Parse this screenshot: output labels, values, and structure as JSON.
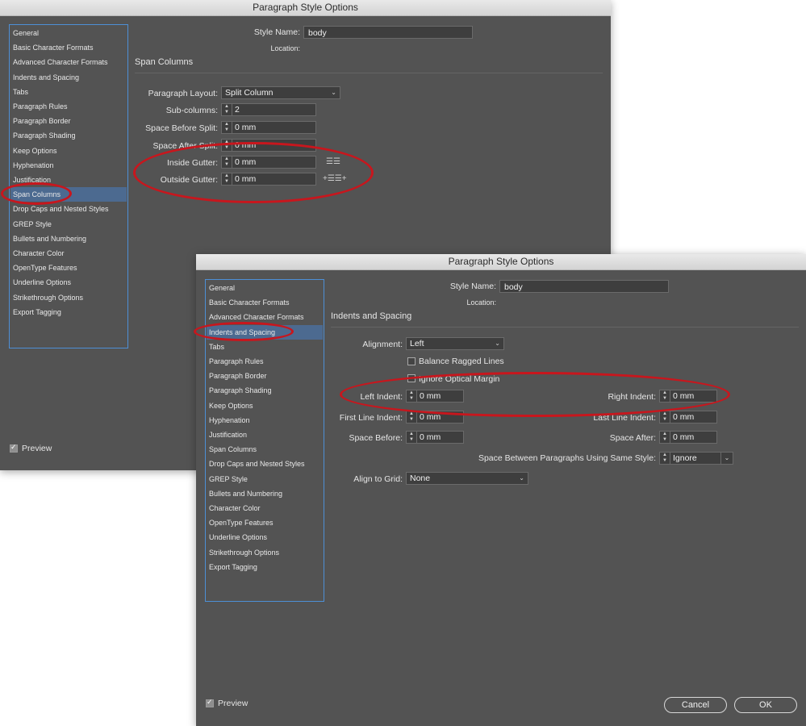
{
  "window1": {
    "title": "Paragraph Style Options",
    "categories": [
      "General",
      "Basic Character Formats",
      "Advanced Character Formats",
      "Indents and Spacing",
      "Tabs",
      "Paragraph Rules",
      "Paragraph Border",
      "Paragraph Shading",
      "Keep Options",
      "Hyphenation",
      "Justification",
      "Span Columns",
      "Drop Caps and Nested Styles",
      "GREP Style",
      "Bullets and Numbering",
      "Character Color",
      "OpenType Features",
      "Underline Options",
      "Strikethrough Options",
      "Export Tagging"
    ],
    "selected": "Span Columns",
    "style_name_label": "Style Name:",
    "style_name_value": "body",
    "location_label": "Location:",
    "section_title": "Span Columns",
    "paragraph_layout_label": "Paragraph Layout:",
    "paragraph_layout_value": "Split Column",
    "sub_columns_label": "Sub-columns:",
    "sub_columns_value": "2",
    "space_before_split_label": "Space Before Split:",
    "space_before_split_value": "0 mm",
    "space_after_split_label": "Space After Split:",
    "space_after_split_value": "0 mm",
    "inside_gutter_label": "Inside Gutter:",
    "inside_gutter_value": "0 mm",
    "outside_gutter_label": "Outside Gutter:",
    "outside_gutter_value": "0 mm",
    "preview_label": "Preview",
    "preview_checked": true
  },
  "window2": {
    "title": "Paragraph Style Options",
    "categories": [
      "General",
      "Basic Character Formats",
      "Advanced Character Formats",
      "Indents and Spacing",
      "Tabs",
      "Paragraph Rules",
      "Paragraph Border",
      "Paragraph Shading",
      "Keep Options",
      "Hyphenation",
      "Justification",
      "Span Columns",
      "Drop Caps and Nested Styles",
      "GREP Style",
      "Bullets and Numbering",
      "Character Color",
      "OpenType Features",
      "Underline Options",
      "Strikethrough Options",
      "Export Tagging"
    ],
    "selected": "Indents and Spacing",
    "style_name_label": "Style Name:",
    "style_name_value": "body",
    "location_label": "Location:",
    "section_title": "Indents and Spacing",
    "alignment_label": "Alignment:",
    "alignment_value": "Left",
    "balance_ragged_label": "Balance Ragged Lines",
    "ignore_optical_label": "Ignore Optical Margin",
    "left_indent_label": "Left Indent:",
    "left_indent_value": "0 mm",
    "right_indent_label": "Right Indent:",
    "right_indent_value": "0 mm",
    "first_line_indent_label": "First Line Indent:",
    "first_line_indent_value": "0 mm",
    "last_line_indent_label": "Last Line Indent:",
    "last_line_indent_value": "0 mm",
    "space_before_label": "Space Before:",
    "space_before_value": "0 mm",
    "space_after_label": "Space After:",
    "space_after_value": "0 mm",
    "space_between_label": "Space Between Paragraphs Using Same Style:",
    "space_between_value": "Ignore",
    "align_grid_label": "Align to Grid:",
    "align_grid_value": "None",
    "preview_label": "Preview",
    "preview_checked": true,
    "cancel_label": "Cancel",
    "ok_label": "OK"
  },
  "colors": {
    "dialog_bg": "#535353",
    "selection": "#4c6a90",
    "list_border": "#4d8fd6",
    "highlight_ellipse": "#c8161d"
  }
}
